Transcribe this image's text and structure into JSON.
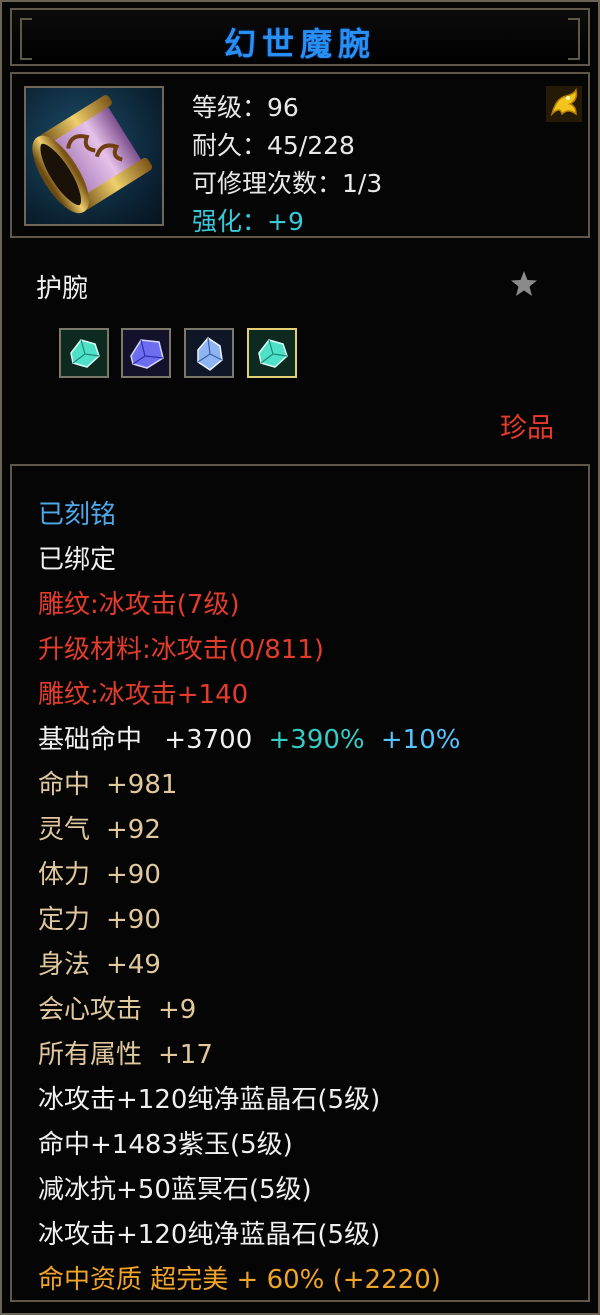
{
  "title": "幻世魔腕",
  "stats": {
    "level_label": "等级：",
    "level_value": "96",
    "durability_label": "耐久：",
    "durability_value": "45/228",
    "repair_label": "可修理次数：",
    "repair_value": "1/3",
    "enhance_label": "强化：",
    "enhance_value": "+9"
  },
  "item_type": "护腕",
  "rarity": "珍品",
  "gems": [
    "cyan-gem",
    "purple-gem",
    "blue-gem",
    "cyan-gem"
  ],
  "attributes": {
    "engraved": "已刻铭",
    "bound": "已绑定",
    "carving": "雕纹:冰攻击(7级)",
    "upgrade": "升级材料:冰攻击(0/811)",
    "carving_bonus": "雕纹:冰攻击+140",
    "base_hit_label": "基础命中",
    "base_hit_value": "+3700",
    "base_hit_pct1": "+390%",
    "base_hit_pct2": "+10%",
    "stats": [
      {
        "label": "命中",
        "value": "+981"
      },
      {
        "label": "灵气",
        "value": "+92"
      },
      {
        "label": "体力",
        "value": "+90"
      },
      {
        "label": "定力",
        "value": "+90"
      },
      {
        "label": "身法",
        "value": "+49"
      },
      {
        "label": "会心攻击",
        "value": "+9"
      },
      {
        "label": "所有属性",
        "value": "+17"
      }
    ],
    "gem_effects": [
      "冰攻击+120纯净蓝晶石(5级)",
      "命中+1483紫玉(5级)",
      "减冰抗+50蓝冥石(5级)",
      "冰攻击+120纯净蓝晶石(5级)"
    ],
    "quality": "命中资质 超完美 + 60% (+2220)"
  },
  "colors": {
    "title": "#2a8ff5",
    "rarity": "#e83a2c",
    "enhance": "#39c8d8",
    "engraved": "#4ea9ea",
    "carving": "#e23c2c",
    "stat": "#e0c79c",
    "quality": "#f0a428"
  }
}
